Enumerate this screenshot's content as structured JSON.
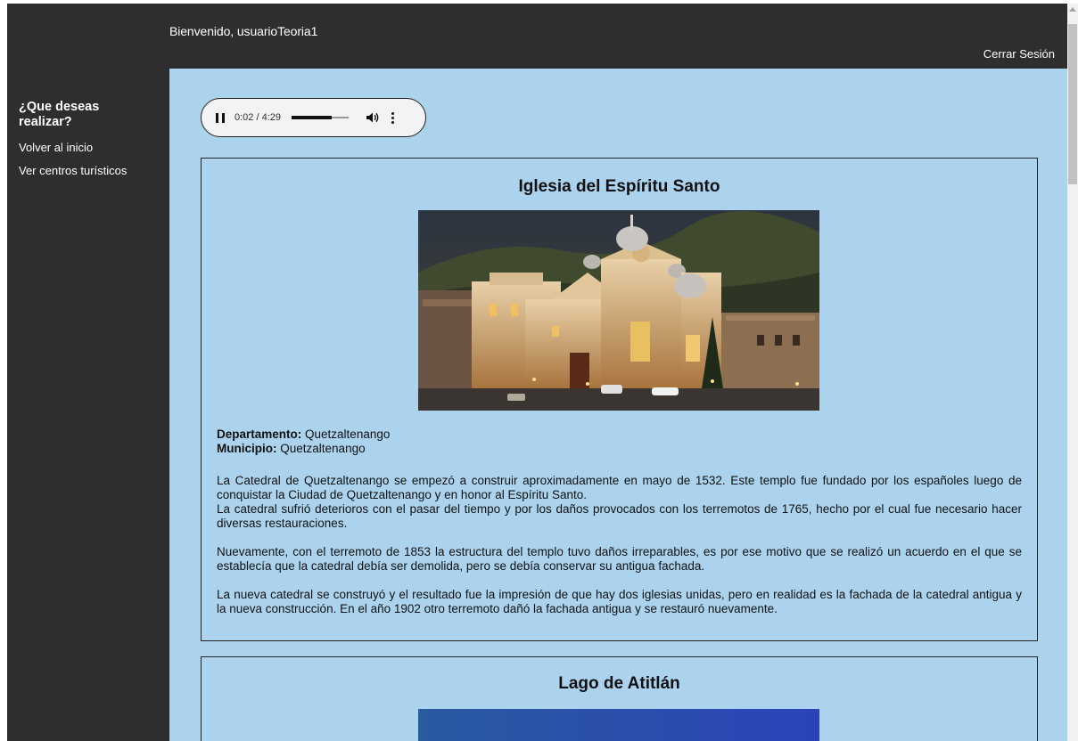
{
  "header": {
    "welcome": "Bienvenido, usuarioTeoria1",
    "logout_label": "Cerrar Sesión"
  },
  "sidebar": {
    "title": "¿Que deseas realizar?",
    "items": [
      {
        "label": "Volver al inicio"
      },
      {
        "label": "Ver centros turísticos"
      }
    ]
  },
  "audio_player": {
    "current_time": "0:02",
    "duration": "4:29",
    "time_display": "0:02 / 4:29",
    "progress_fraction": 0.71,
    "state": "playing",
    "icons": [
      "pause-icon",
      "volume-icon",
      "more-options-icon"
    ]
  },
  "places": [
    {
      "name": "Iglesia del Espíritu Santo",
      "department_label": "Departamento:",
      "department": "Quetzaltenango",
      "municipality_label": "Municipio:",
      "municipality": "Quetzaltenango",
      "description": [
        "La Catedral de Quetzaltenango se empezó a construir aproximadamente en mayo de 1532. Este templo fue fundado por los españoles luego de conquistar la Ciudad de Quetzaltenango y en honor al Espíritu Santo.",
        "La catedral sufrió deterioros con el pasar del tiempo y por los daños provocados con los terremotos de 1765, hecho por el cual fue necesario hacer diversas restauraciones.",
        "Nuevamente, con el terremoto de 1853 la estructura del templo tuvo daños irreparables, es por ese motivo que se realizó un acuerdo en el que se establecía que la catedral debía ser demolida, pero se debía conservar su antigua fachada.",
        "La nueva catedral se construyó y el resultado fue la impresión de que hay dos iglesias unidas, pero en realidad es la fachada de la catedral antigua y la nueva construcción. En el año 1902 otro terremoto dañó la fachada antigua y se restauró nuevamente."
      ]
    },
    {
      "name": "Lago de Atitlán"
    }
  ],
  "colors": {
    "sidebar_bg": "#2e2e2e",
    "content_bg": "#abd3ee",
    "text": "#111111"
  }
}
